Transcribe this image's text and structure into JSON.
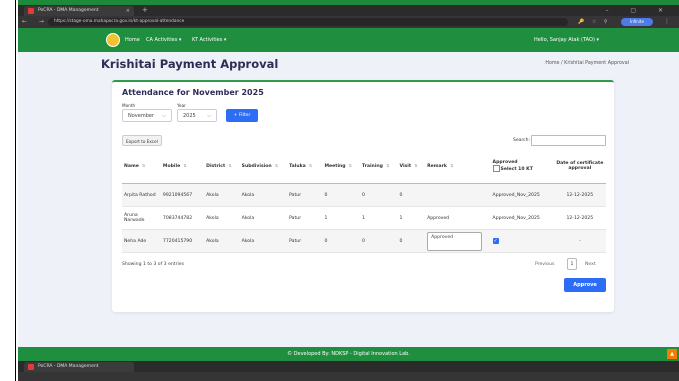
{
  "browser": {
    "tab_title": "PoCRA - DMA Management",
    "tab_close": "×",
    "new_tab": "+",
    "window_controls": "–  ▢  ✕",
    "nav_buttons": "←  →  ⟳",
    "url": "https://stage-oma.mahapocra.gov.in/kt-approval-attendance",
    "addr_icons": "🔑 ☆ ⚲",
    "profile_label": "Infinite",
    "menu": "⋮"
  },
  "navbar": {
    "home": "Home",
    "ca_activities": "CA Activities ▾",
    "kt_activities": "KT Activities ▾",
    "user": "Hello, Sanjay Atak (TAO) ▾"
  },
  "page": {
    "title": "Krishitai Payment Approval",
    "breadcrumb": "Home / Krishitai Payment Approval"
  },
  "card": {
    "title": "Attendance for November 2025",
    "month_label": "Month",
    "year_label": "Year",
    "month_value": "November",
    "year_value": "2025",
    "filter_label": "Filter",
    "export_label": "Export to Excel",
    "search_label": "Search:",
    "table": {
      "headers": {
        "name": "Name",
        "mobile": "Mobile",
        "district": "District",
        "subdivision": "Subdivision",
        "taluka": "Taluka",
        "meeting": "Meeting",
        "training": "Training",
        "visit": "Visit",
        "remark": "Remark",
        "approved": "Approved",
        "select10": "Select 10 KT",
        "cert_date": "Date of certificate approval"
      },
      "rows": [
        {
          "name": "Arpita Rathod",
          "mobile": "9921094567",
          "district": "Akola",
          "subdivision": "Akola",
          "taluka": "Patur",
          "meeting": "0",
          "training": "0",
          "visit": "0",
          "remark": "",
          "approved": "Approved_Nov_2025",
          "cert_date": "12-12-2025"
        },
        {
          "name": "Aruna Narwade",
          "mobile": "7083744782",
          "district": "Akola",
          "subdivision": "Akola",
          "taluka": "Patur",
          "meeting": "1",
          "training": "1",
          "visit": "1",
          "remark": "Approved",
          "approved": "Approved_Nov_2025",
          "cert_date": "12-12-2025"
        },
        {
          "name": "Neha Ade",
          "mobile": "7720415790",
          "district": "Akola",
          "subdivision": "Akola",
          "taluka": "Patur",
          "meeting": "0",
          "training": "0",
          "visit": "0",
          "remark": "Approved",
          "approved": "",
          "cert_date": "-"
        }
      ]
    },
    "showing": "Showing 1 to 3 of 3 entries",
    "previous": "Previous",
    "page_num": "1",
    "next": "Next",
    "approve_label": "Approve"
  },
  "footer": {
    "text": "© Developed By: NDKSP - Digital Innovation Lab."
  },
  "colors": {
    "green": "#1f8f3f",
    "blue": "#2d6df6",
    "title": "#2d2d55"
  }
}
